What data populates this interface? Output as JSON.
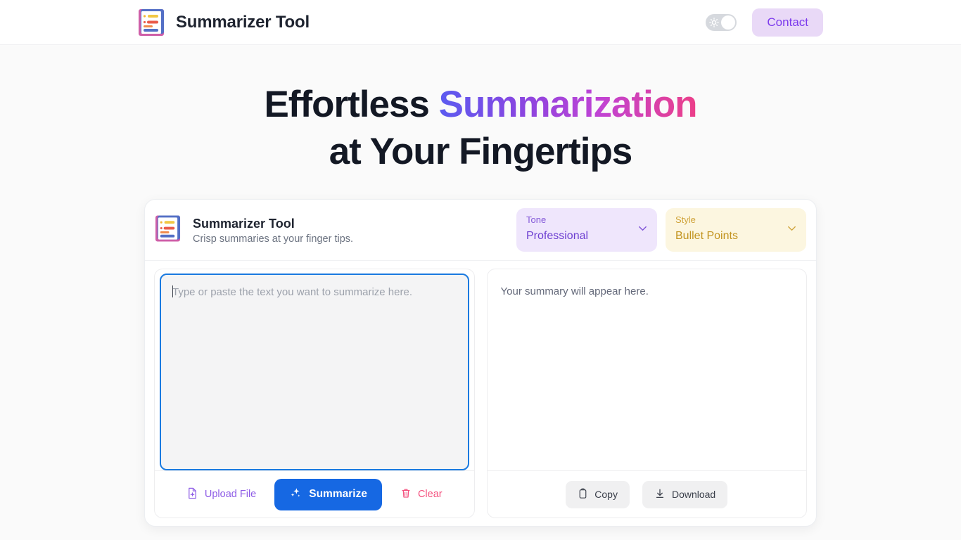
{
  "header": {
    "brand_title": "Summarizer Tool",
    "logo_icon": "document-lines-icon",
    "theme_toggle_icon": "sun-icon",
    "contact_label": "Contact"
  },
  "hero": {
    "line1_plain": "Effortless ",
    "line1_gradient": "Summarization",
    "line2": "at Your Fingertips",
    "gradient_start": "#5b5bf0",
    "gradient_end": "#ec3f88"
  },
  "card": {
    "title": "Summarizer Tool",
    "subtitle": "Crisp summaries at your finger tips.",
    "logo_icon": "document-lines-icon",
    "tone_select": {
      "label": "Tone",
      "value": "Professional",
      "chevron_icon": "chevron-down-icon",
      "bg_color": "#efe6fc",
      "text_color": "#6d3fd1"
    },
    "style_select": {
      "label": "Style",
      "value": "Bullet Points",
      "chevron_icon": "chevron-down-icon",
      "bg_color": "#fcf6e0",
      "text_color": "#c2941f"
    },
    "input_panel": {
      "placeholder": "Type or paste the text you want to summarize here.",
      "value": "",
      "focused": true,
      "upload_label": "Upload File",
      "upload_icon": "file-plus-icon",
      "summarize_label": "Summarize",
      "summarize_icon": "sparkles-icon",
      "summarize_color": "#1668e3",
      "clear_label": "Clear",
      "clear_icon": "trash-icon"
    },
    "output_panel": {
      "placeholder": "Your summary will appear here.",
      "copy_label": "Copy",
      "copy_icon": "clipboard-icon",
      "download_label": "Download",
      "download_icon": "download-icon"
    }
  }
}
